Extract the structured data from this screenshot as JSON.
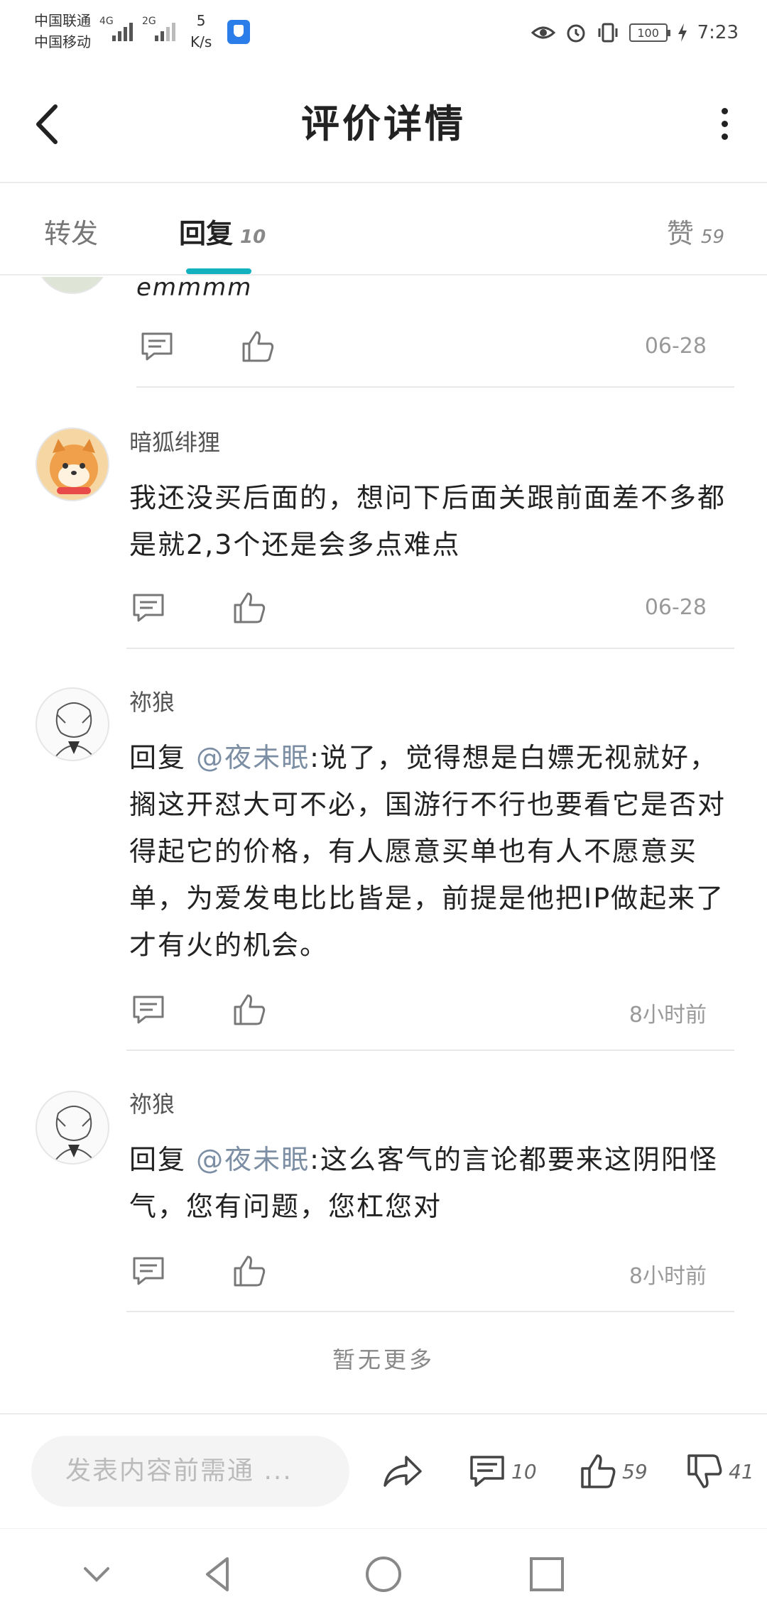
{
  "status_bar": {
    "carrier1": "中国联通",
    "carrier2": "中国移动",
    "net1": "4G",
    "net2": "2G",
    "speed_value": "5",
    "speed_unit": "K/s",
    "battery": "100",
    "time": "7:23"
  },
  "header": {
    "title": "评价详情"
  },
  "tabs": {
    "forward_label": "转发",
    "reply_label": "回复",
    "reply_count": "10",
    "likes_label": "赞",
    "likes_count": "59"
  },
  "comments": [
    {
      "username": "",
      "content": "emmmm",
      "time": "06-28"
    },
    {
      "username": "暗狐绯狸",
      "content": "我还没买后面的，想问下后面关跟前面差不多都是就2,3个还是会多点难点",
      "time": "06-28"
    },
    {
      "username": "祢狼",
      "reply_prefix": "回复 ",
      "mention": "@夜未眠",
      "content": ":说了，觉得想是白嫖无视就好，搁这开怼大可不必，国游行不行也要看它是否对得起它的价格，有人愿意买单也有人不愿意买单，为爱发电比比皆是，前提是他把IP做起来了才有火的机会。",
      "time": "8小时前"
    },
    {
      "username": "祢狼",
      "reply_prefix": "回复 ",
      "mention": "@夜未眠",
      "content": ":这么客气的言论都要来这阴阳怪气，您有问题，您杠您对",
      "time": "8小时前"
    }
  ],
  "footer_note": "暂无更多",
  "bottom_bar": {
    "input_placeholder": "发表内容前需通 ...",
    "comment_count": "10",
    "like_count": "59",
    "dislike_count": "41"
  },
  "icons": {
    "back": "chevron-left-icon",
    "more": "more-vertical-icon",
    "comment": "comment-icon",
    "like": "thumbs-up-icon",
    "share": "share-icon",
    "dislike": "thumbs-down-icon"
  },
  "colors": {
    "accent": "#14b1bf",
    "mention": "#7b8ea3"
  }
}
